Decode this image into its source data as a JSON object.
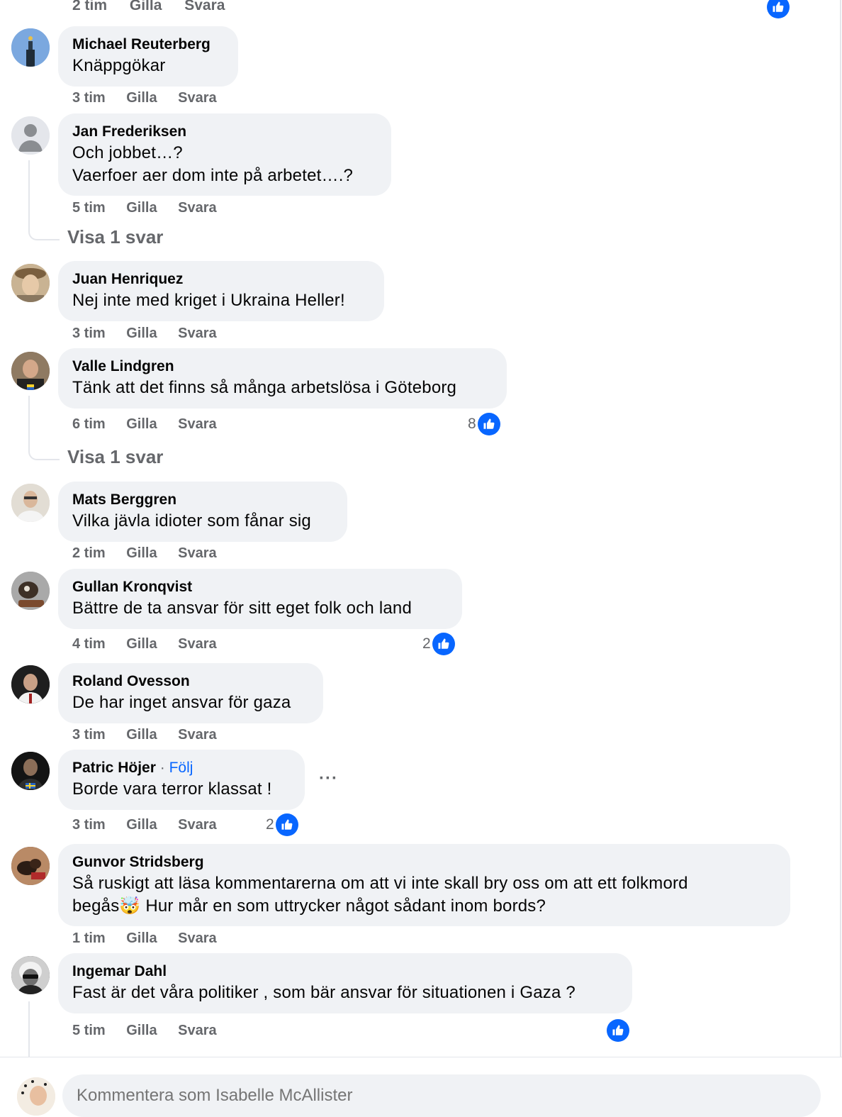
{
  "top_meta": {
    "time": "2 tim",
    "like": "Gilla",
    "reply": "Svara"
  },
  "comments": [
    {
      "name": "Michael Reuterberg",
      "lines": [
        "Knäppgökar"
      ],
      "time": "3 tim",
      "like": "Gilla",
      "reply": "Svara"
    },
    {
      "name": "Jan Frederiksen",
      "lines": [
        "Och jobbet…?",
        "Vaerfoer aer dom inte på arbetet….?"
      ],
      "time": "5 tim",
      "like": "Gilla",
      "reply": "Svara",
      "view_replies": "Visa 1 svar"
    },
    {
      "name": "Juan Henriquez",
      "lines": [
        "Nej inte med kriget i Ukraina Heller!"
      ],
      "time": "3 tim",
      "like": "Gilla",
      "reply": "Svara"
    },
    {
      "name": "Valle Lindgren",
      "lines": [
        "Tänk att det finns så många arbetslösa i Göteborg"
      ],
      "time": "6 tim",
      "like": "Gilla",
      "reply": "Svara",
      "reactions": "8",
      "view_replies": "Visa 1 svar"
    },
    {
      "name": "Mats Berggren",
      "lines": [
        "Vilka jävla idioter som fånar sig"
      ],
      "time": "2 tim",
      "like": "Gilla",
      "reply": "Svara"
    },
    {
      "name": "Gullan Kronqvist",
      "lines": [
        "Bättre de ta ansvar för sitt eget folk och land"
      ],
      "time": "4 tim",
      "like": "Gilla",
      "reply": "Svara",
      "reactions": "2"
    },
    {
      "name": "Roland Ovesson",
      "lines": [
        "De har inget ansvar för gaza"
      ],
      "time": "3 tim",
      "like": "Gilla",
      "reply": "Svara"
    },
    {
      "name": "Patric Höjer",
      "separator": "·",
      "follow": "Följ",
      "lines": [
        "Borde vara terror klassat !"
      ],
      "time": "3 tim",
      "like": "Gilla",
      "reply": "Svara",
      "reactions": "2",
      "more": "···"
    },
    {
      "name": "Gunvor Stridsberg",
      "lines": [
        "Så ruskigt att läsa kommentarerna om att vi inte skall bry oss om att ett folkmord",
        "begås🤯 Hur mår en som uttrycker något sådant inom bords?"
      ],
      "time": "1 tim",
      "like": "Gilla",
      "reply": "Svara"
    },
    {
      "name": "Ingemar Dahl",
      "lines": [
        "Fast är det våra politiker , som bär ansvar för situationen i Gaza ?"
      ],
      "time": "5 tim",
      "like": "Gilla",
      "reply": "Svara"
    }
  ],
  "composer": {
    "placeholder": "Kommentera som Isabelle McAllister"
  },
  "colors": {
    "accent": "#0866ff",
    "bubble": "#f0f2f5",
    "meta": "#65676b"
  }
}
